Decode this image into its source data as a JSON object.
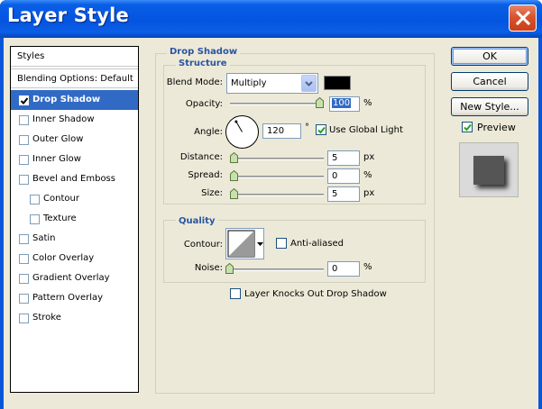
{
  "window": {
    "title": "Layer Style"
  },
  "styles": {
    "header": "Styles",
    "blending_options": "Blending Options: Default",
    "items": [
      {
        "label": "Drop Shadow",
        "checked": true,
        "selected": true,
        "indent": false
      },
      {
        "label": "Inner Shadow",
        "checked": false,
        "selected": false,
        "indent": false
      },
      {
        "label": "Outer Glow",
        "checked": false,
        "selected": false,
        "indent": false
      },
      {
        "label": "Inner Glow",
        "checked": false,
        "selected": false,
        "indent": false
      },
      {
        "label": "Bevel and Emboss",
        "checked": false,
        "selected": false,
        "indent": false
      },
      {
        "label": "Contour",
        "checked": false,
        "selected": false,
        "indent": true
      },
      {
        "label": "Texture",
        "checked": false,
        "selected": false,
        "indent": true
      },
      {
        "label": "Satin",
        "checked": false,
        "selected": false,
        "indent": false
      },
      {
        "label": "Color Overlay",
        "checked": false,
        "selected": false,
        "indent": false
      },
      {
        "label": "Gradient Overlay",
        "checked": false,
        "selected": false,
        "indent": false
      },
      {
        "label": "Pattern Overlay",
        "checked": false,
        "selected": false,
        "indent": false
      },
      {
        "label": "Stroke",
        "checked": false,
        "selected": false,
        "indent": false
      }
    ]
  },
  "drop_shadow": {
    "title": "Drop Shadow",
    "structure": {
      "title": "Structure",
      "blend_mode_label": "Blend Mode:",
      "blend_mode_value": "Multiply",
      "shadow_color": "#000000",
      "opacity_label": "Opacity:",
      "opacity_value": "100",
      "opacity_unit": "%",
      "opacity_fraction": 1.0,
      "angle_label": "Angle:",
      "angle_value": "120",
      "angle_unit": "°",
      "use_global_light_label": "Use Global Light",
      "use_global_light": true,
      "distance_label": "Distance:",
      "distance_value": "5",
      "distance_unit": "px",
      "spread_label": "Spread:",
      "spread_value": "0",
      "spread_unit": "%",
      "size_label": "Size:",
      "size_value": "5",
      "size_unit": "px"
    },
    "quality": {
      "title": "Quality",
      "contour_label": "Contour:",
      "anti_aliased_label": "Anti-aliased",
      "anti_aliased": false,
      "noise_label": "Noise:",
      "noise_value": "0",
      "noise_unit": "%"
    },
    "knockout_label": "Layer Knocks Out Drop Shadow",
    "knockout": false
  },
  "buttons": {
    "ok": "OK",
    "cancel": "Cancel",
    "new_style": "New Style...",
    "preview_label": "Preview",
    "preview_checked": true
  },
  "colors": {
    "titlebar": "#0454e0",
    "selection": "#316ac5",
    "group_title": "#2a55a0",
    "close_button": "#d9532e"
  }
}
